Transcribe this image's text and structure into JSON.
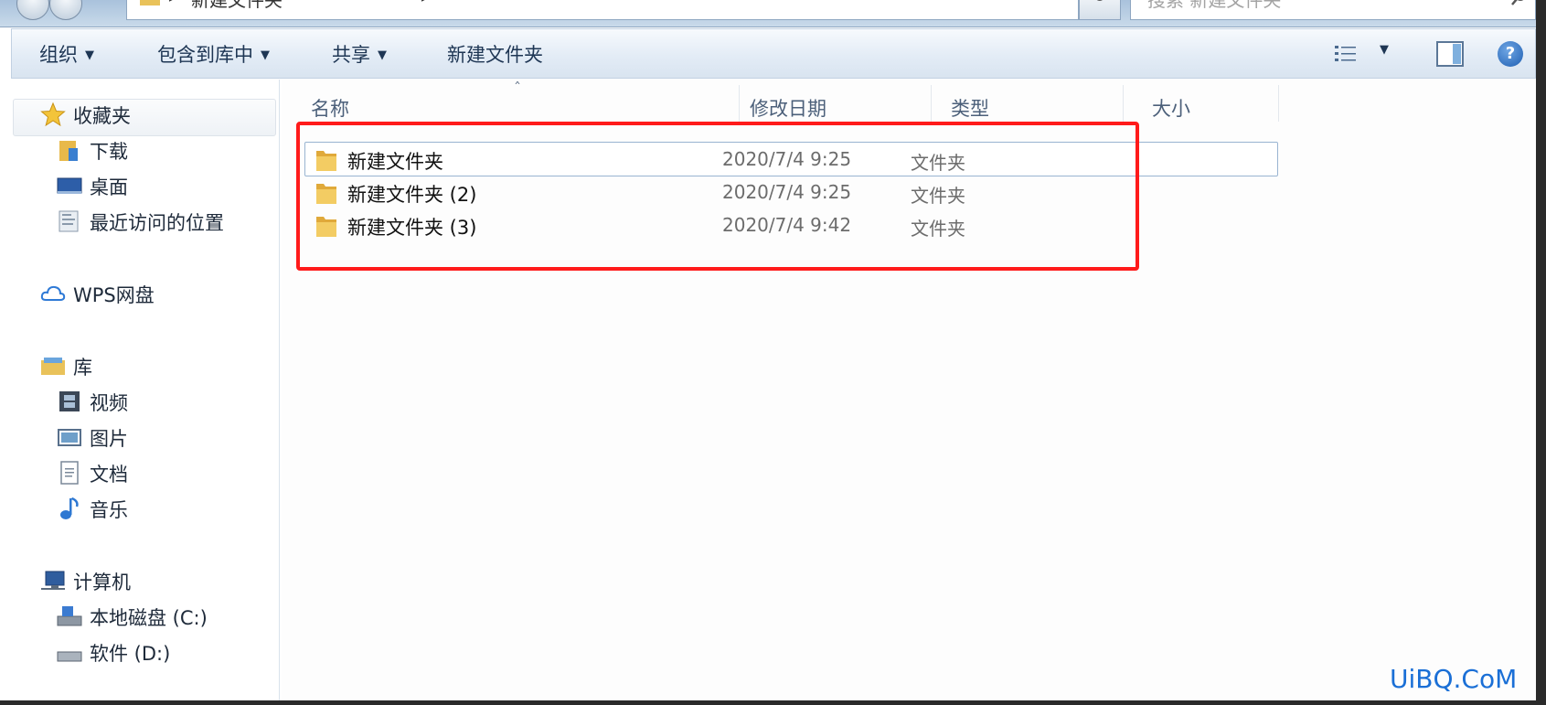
{
  "address_bar": {
    "path_text": "新建文件夹",
    "separator": "▸",
    "dropdown_glyph": "▾",
    "refresh_glyph": "↻",
    "search_placeholder": "搜索 新建文件夹"
  },
  "toolbar": {
    "organize": "组织",
    "include_in_library": "包含到库中",
    "share": "共享",
    "new_folder": "新建文件夹",
    "dropdown_glyph": "▼",
    "help_glyph": "?"
  },
  "nav": {
    "favorites": "收藏夹",
    "downloads": "下载",
    "desktop": "桌面",
    "recent": "最近访问的位置",
    "wps": "WPS网盘",
    "library": "库",
    "videos": "视频",
    "pictures": "图片",
    "documents": "文档",
    "music": "音乐",
    "computer": "计算机",
    "local_disk_c": "本地磁盘 (C:)",
    "disk_d": "软件 (D:)"
  },
  "columns": {
    "name": "名称",
    "modified": "修改日期",
    "type": "类型",
    "size": "大小",
    "sort_glyph": "ˆ"
  },
  "files": [
    {
      "name": "新建文件夹",
      "modified": "2020/7/4 9:25",
      "type": "文件夹"
    },
    {
      "name": "新建文件夹 (2)",
      "modified": "2020/7/4 9:25",
      "type": "文件夹"
    },
    {
      "name": "新建文件夹 (3)",
      "modified": "2020/7/4 9:42",
      "type": "文件夹"
    }
  ],
  "watermark": "UiBQ.CoM",
  "colors": {
    "highlight": "#ff1a1a",
    "toolbar_text": "#1e3654",
    "selection_border": "#99b4d1"
  }
}
